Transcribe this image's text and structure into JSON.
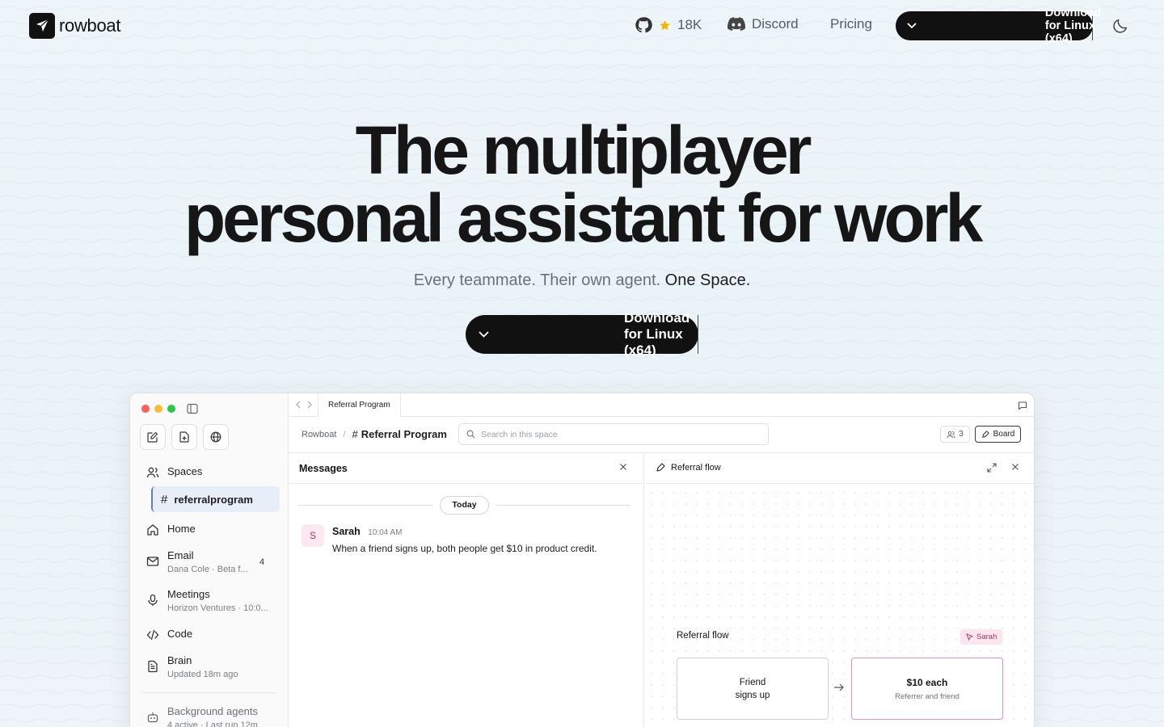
{
  "brand": {
    "name": "rowboat"
  },
  "nav": {
    "github_stars": "18K",
    "discord": "Discord",
    "pricing": "Pricing",
    "download": "Download for Linux (x64)"
  },
  "hero": {
    "title_line1": "The multiplayer",
    "title_line2": "personal assistant for work",
    "subtitle_muted": "Every teammate. Their own agent.",
    "subtitle_strong": "One Space.",
    "download": "Download for Linux (x64)"
  },
  "colors": {
    "accent_dark": "#111111",
    "background": "#eaf3f8",
    "pink_accent": "#e58fb1",
    "active_blue": "#5a7fc2"
  },
  "app": {
    "sidebar": {
      "spaces": "Spaces",
      "active_space": "referralprogram",
      "home": "Home",
      "email": {
        "label": "Email",
        "sub": "Dana Cole · Beta f...",
        "badge": "4"
      },
      "meetings": {
        "label": "Meetings",
        "sub": "Horizon Ventures · 10:0..."
      },
      "code": "Code",
      "brain": {
        "label": "Brain",
        "sub": "Updated 18m ago"
      },
      "agents": {
        "label": "Background agents",
        "sub": "4 active · Last run 12m"
      }
    },
    "tab": "Referral Program",
    "breadcrumb": {
      "root": "Rowboat",
      "current": "Referral Program"
    },
    "search_placeholder": "Search in this space",
    "members_count": "3",
    "board_label": "Board",
    "messages": {
      "title": "Messages",
      "day": "Today",
      "items": [
        {
          "initial": "S",
          "name": "Sarah",
          "time": "10:04 AM",
          "text": "When a friend signs up, both people get $10 in product credit."
        }
      ]
    },
    "flow": {
      "title": "Referral flow",
      "board_title": "Referral flow",
      "author_tag": "Sarah",
      "node1": {
        "line1": "Friend",
        "line2": "signs up"
      },
      "node2": {
        "title": "$10 each",
        "sub": "Referrer and friend"
      }
    }
  }
}
